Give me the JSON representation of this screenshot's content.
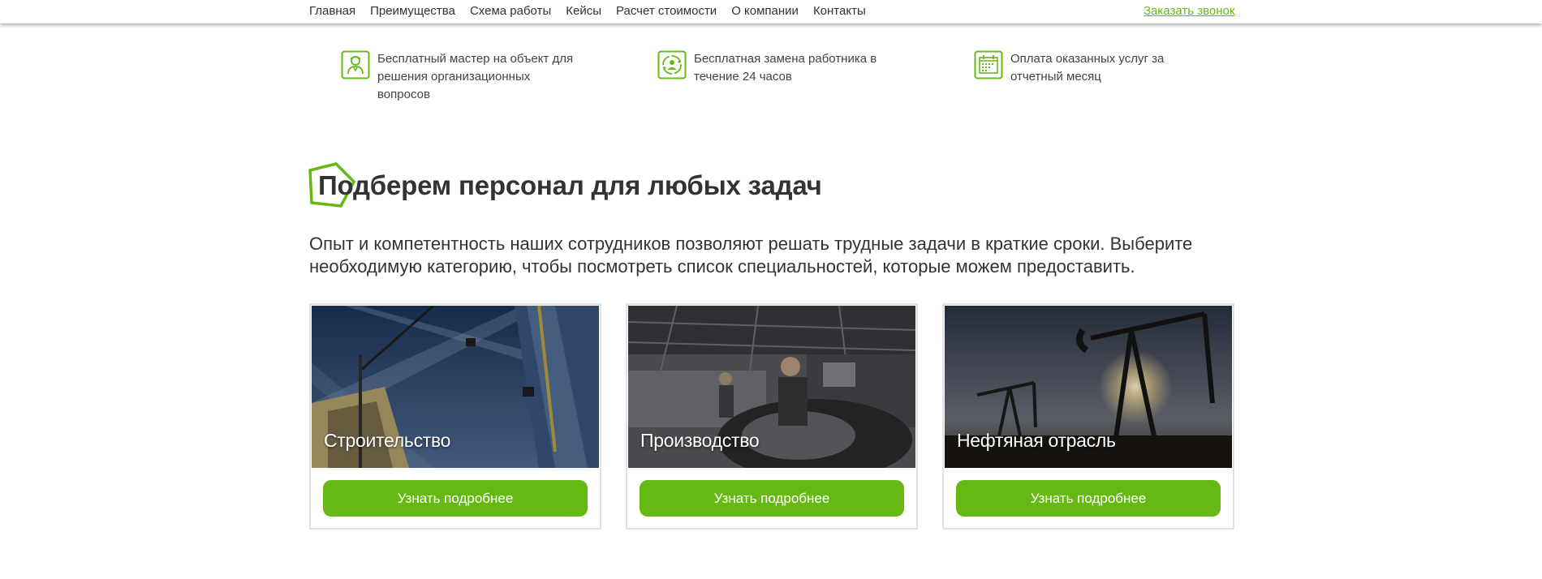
{
  "nav": {
    "items": [
      "Главная",
      "Преимущества",
      "Схема работы",
      "Кейсы",
      "Расчет стоимости",
      "О компании",
      "Контакты"
    ],
    "callback": "Заказать звонок"
  },
  "benefits": [
    {
      "icon": "worker-icon",
      "text": "Бесплатный мастер на объект для решения организационных вопросов"
    },
    {
      "icon": "replacement-icon",
      "text": "Бесплатная замена работника в течение 24 часов"
    },
    {
      "icon": "calendar-icon",
      "text": "Оплата оказанных услуг за отчетный месяц"
    }
  ],
  "section": {
    "title": "Подберем персонал для любых задач",
    "description": "Опыт и компетентность наших сотрудников позволяют решать трудные задачи в краткие сроки. Выберите необходимую категорию, чтобы посмотреть список специальностей, которые можем предоставить."
  },
  "cards": [
    {
      "title": "Строительство",
      "button": "Узнать подробнее",
      "image": "construction-crane-photo"
    },
    {
      "title": "Производство",
      "button": "Узнать подробнее",
      "image": "factory-assembly-photo"
    },
    {
      "title": "Нефтяная отрасль",
      "button": "Узнать подробнее",
      "image": "oil-pumpjack-photo"
    }
  ],
  "colors": {
    "accent": "#66b814",
    "text": "#333333",
    "card_border": "#e2e2e2"
  }
}
